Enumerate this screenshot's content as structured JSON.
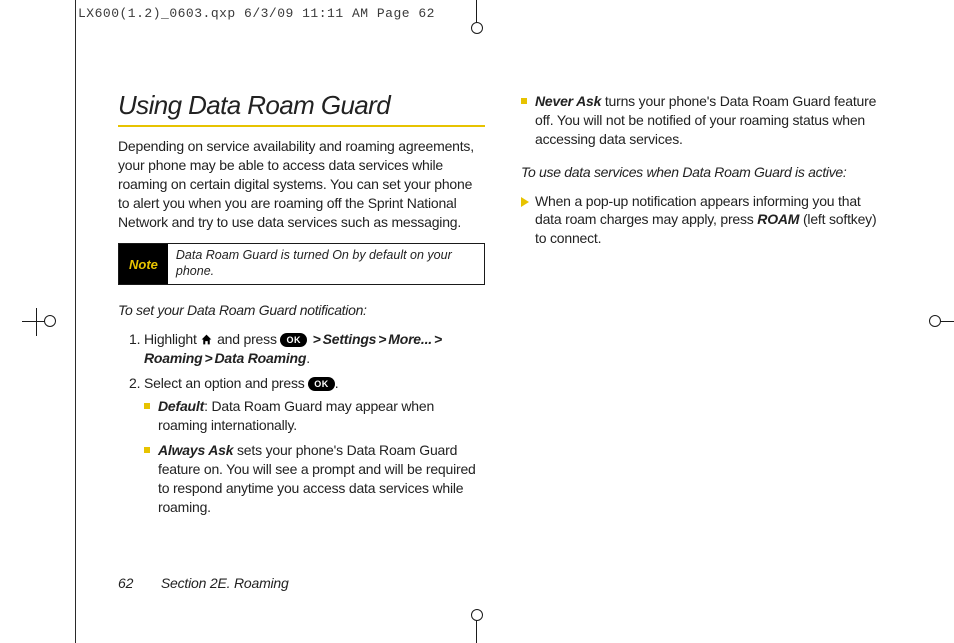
{
  "slug": "LX600(1.2)_0603.qxp  6/3/09  11:11 AM  Page 62",
  "title": "Using Data Roam Guard",
  "intro": "Depending on service availability and roaming agreements, your phone may be able to access data services while roaming on certain digital systems. You can set your phone to alert you when you are roaming off the Sprint National Network and try to use data services such as messaging.",
  "note": {
    "label": "Note",
    "text": "Data Roam Guard is turned On by default on your phone."
  },
  "subhead1": "To set your Data Roam Guard notification:",
  "step1_pre": "Highlight ",
  "step1_mid": " and press ",
  "ok_label": "OK",
  "menu_path": [
    "Settings",
    "More...",
    "Roaming",
    "Data Roaming"
  ],
  "step1_end": ".",
  "step2_pre": "Select an option and press ",
  "step2_end": ".",
  "options": {
    "default": {
      "term": "Default",
      "text": ": Data Roam Guard may appear when roaming internationally."
    },
    "always": {
      "term": "Always Ask",
      "text": " sets your phone's Data Roam Guard feature on. You will see a prompt and will be required to respond anytime you access data services while roaming."
    },
    "never": {
      "term": "Never Ask",
      "text": " turns your phone's Data Roam Guard feature off. You will not be notified of your roaming status when accessing data services."
    }
  },
  "subhead2": "To use data services when Data Roam Guard is active:",
  "active_step_pre": "When a pop-up notification appears informing you that data roam charges may apply, press ",
  "active_step_key": "ROAM",
  "active_step_post": " (left softkey) to connect.",
  "footer": {
    "page": "62",
    "section": "Section 2E. Roaming"
  },
  "gt": ">"
}
